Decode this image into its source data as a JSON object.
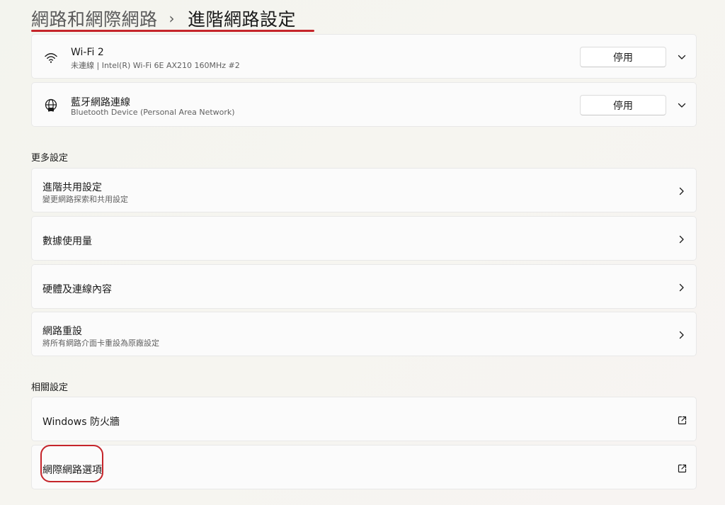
{
  "breadcrumb": {
    "parent": "網路和網際網路",
    "separator": "›",
    "current": "進階網路設定"
  },
  "adapters": [
    {
      "icon": "wifi-icon",
      "name": "Wi-Fi 2",
      "detail": "未連線 | Intel(R) Wi-Fi 6E AX210 160MHz #2",
      "button": "停用"
    },
    {
      "icon": "globe-network-icon",
      "name": "藍牙網路連線",
      "detail": "Bluetooth Device (Personal Area Network)",
      "button": "停用"
    }
  ],
  "more_settings": {
    "heading": "更多設定",
    "items": [
      {
        "title": "進階共用設定",
        "subtitle": "變更網路探索和共用設定"
      },
      {
        "title": "數據使用量"
      },
      {
        "title": "硬體及連線內容"
      },
      {
        "title": "網路重設",
        "subtitle": "將所有網路介面卡重設為原廠設定"
      }
    ]
  },
  "related_settings": {
    "heading": "相關設定",
    "items": [
      {
        "title": "Windows 防火牆"
      },
      {
        "title": "網際網路選項"
      }
    ]
  },
  "annotation_color": "#c5242a"
}
